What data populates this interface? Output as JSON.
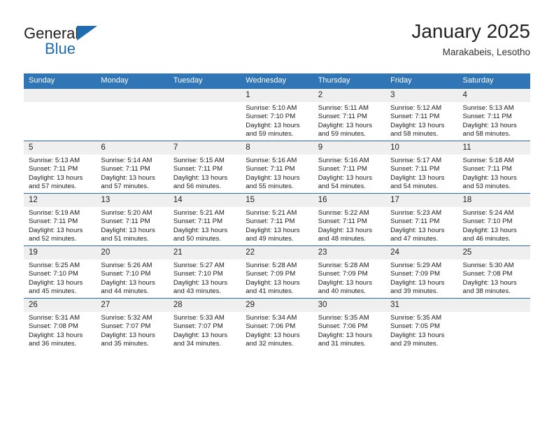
{
  "brand": {
    "name_line1": "General",
    "name_line2": "Blue",
    "triangle_color": "#1f6cb0"
  },
  "header": {
    "title": "January 2025",
    "subtitle": "Marakabeis, Lesotho"
  },
  "theme": {
    "header_bg": "#3075b5",
    "cell_border": "#2a6aa8",
    "daynum_bg": "#efefef",
    "accent": "#1f6cb0"
  },
  "weekday_headers": [
    "Sunday",
    "Monday",
    "Tuesday",
    "Wednesday",
    "Thursday",
    "Friday",
    "Saturday"
  ],
  "weeks": [
    [
      {
        "day": "",
        "sunrise": "",
        "sunset": "",
        "daylight_line1": "",
        "daylight_line2": ""
      },
      {
        "day": "",
        "sunrise": "",
        "sunset": "",
        "daylight_line1": "",
        "daylight_line2": ""
      },
      {
        "day": "",
        "sunrise": "",
        "sunset": "",
        "daylight_line1": "",
        "daylight_line2": ""
      },
      {
        "day": "1",
        "sunrise": "Sunrise: 5:10 AM",
        "sunset": "Sunset: 7:10 PM",
        "daylight_line1": "Daylight: 13 hours",
        "daylight_line2": "and 59 minutes."
      },
      {
        "day": "2",
        "sunrise": "Sunrise: 5:11 AM",
        "sunset": "Sunset: 7:11 PM",
        "daylight_line1": "Daylight: 13 hours",
        "daylight_line2": "and 59 minutes."
      },
      {
        "day": "3",
        "sunrise": "Sunrise: 5:12 AM",
        "sunset": "Sunset: 7:11 PM",
        "daylight_line1": "Daylight: 13 hours",
        "daylight_line2": "and 58 minutes."
      },
      {
        "day": "4",
        "sunrise": "Sunrise: 5:13 AM",
        "sunset": "Sunset: 7:11 PM",
        "daylight_line1": "Daylight: 13 hours",
        "daylight_line2": "and 58 minutes."
      }
    ],
    [
      {
        "day": "5",
        "sunrise": "Sunrise: 5:13 AM",
        "sunset": "Sunset: 7:11 PM",
        "daylight_line1": "Daylight: 13 hours",
        "daylight_line2": "and 57 minutes."
      },
      {
        "day": "6",
        "sunrise": "Sunrise: 5:14 AM",
        "sunset": "Sunset: 7:11 PM",
        "daylight_line1": "Daylight: 13 hours",
        "daylight_line2": "and 57 minutes."
      },
      {
        "day": "7",
        "sunrise": "Sunrise: 5:15 AM",
        "sunset": "Sunset: 7:11 PM",
        "daylight_line1": "Daylight: 13 hours",
        "daylight_line2": "and 56 minutes."
      },
      {
        "day": "8",
        "sunrise": "Sunrise: 5:16 AM",
        "sunset": "Sunset: 7:11 PM",
        "daylight_line1": "Daylight: 13 hours",
        "daylight_line2": "and 55 minutes."
      },
      {
        "day": "9",
        "sunrise": "Sunrise: 5:16 AM",
        "sunset": "Sunset: 7:11 PM",
        "daylight_line1": "Daylight: 13 hours",
        "daylight_line2": "and 54 minutes."
      },
      {
        "day": "10",
        "sunrise": "Sunrise: 5:17 AM",
        "sunset": "Sunset: 7:11 PM",
        "daylight_line1": "Daylight: 13 hours",
        "daylight_line2": "and 54 minutes."
      },
      {
        "day": "11",
        "sunrise": "Sunrise: 5:18 AM",
        "sunset": "Sunset: 7:11 PM",
        "daylight_line1": "Daylight: 13 hours",
        "daylight_line2": "and 53 minutes."
      }
    ],
    [
      {
        "day": "12",
        "sunrise": "Sunrise: 5:19 AM",
        "sunset": "Sunset: 7:11 PM",
        "daylight_line1": "Daylight: 13 hours",
        "daylight_line2": "and 52 minutes."
      },
      {
        "day": "13",
        "sunrise": "Sunrise: 5:20 AM",
        "sunset": "Sunset: 7:11 PM",
        "daylight_line1": "Daylight: 13 hours",
        "daylight_line2": "and 51 minutes."
      },
      {
        "day": "14",
        "sunrise": "Sunrise: 5:21 AM",
        "sunset": "Sunset: 7:11 PM",
        "daylight_line1": "Daylight: 13 hours",
        "daylight_line2": "and 50 minutes."
      },
      {
        "day": "15",
        "sunrise": "Sunrise: 5:21 AM",
        "sunset": "Sunset: 7:11 PM",
        "daylight_line1": "Daylight: 13 hours",
        "daylight_line2": "and 49 minutes."
      },
      {
        "day": "16",
        "sunrise": "Sunrise: 5:22 AM",
        "sunset": "Sunset: 7:11 PM",
        "daylight_line1": "Daylight: 13 hours",
        "daylight_line2": "and 48 minutes."
      },
      {
        "day": "17",
        "sunrise": "Sunrise: 5:23 AM",
        "sunset": "Sunset: 7:11 PM",
        "daylight_line1": "Daylight: 13 hours",
        "daylight_line2": "and 47 minutes."
      },
      {
        "day": "18",
        "sunrise": "Sunrise: 5:24 AM",
        "sunset": "Sunset: 7:10 PM",
        "daylight_line1": "Daylight: 13 hours",
        "daylight_line2": "and 46 minutes."
      }
    ],
    [
      {
        "day": "19",
        "sunrise": "Sunrise: 5:25 AM",
        "sunset": "Sunset: 7:10 PM",
        "daylight_line1": "Daylight: 13 hours",
        "daylight_line2": "and 45 minutes."
      },
      {
        "day": "20",
        "sunrise": "Sunrise: 5:26 AM",
        "sunset": "Sunset: 7:10 PM",
        "daylight_line1": "Daylight: 13 hours",
        "daylight_line2": "and 44 minutes."
      },
      {
        "day": "21",
        "sunrise": "Sunrise: 5:27 AM",
        "sunset": "Sunset: 7:10 PM",
        "daylight_line1": "Daylight: 13 hours",
        "daylight_line2": "and 43 minutes."
      },
      {
        "day": "22",
        "sunrise": "Sunrise: 5:28 AM",
        "sunset": "Sunset: 7:09 PM",
        "daylight_line1": "Daylight: 13 hours",
        "daylight_line2": "and 41 minutes."
      },
      {
        "day": "23",
        "sunrise": "Sunrise: 5:28 AM",
        "sunset": "Sunset: 7:09 PM",
        "daylight_line1": "Daylight: 13 hours",
        "daylight_line2": "and 40 minutes."
      },
      {
        "day": "24",
        "sunrise": "Sunrise: 5:29 AM",
        "sunset": "Sunset: 7:09 PM",
        "daylight_line1": "Daylight: 13 hours",
        "daylight_line2": "and 39 minutes."
      },
      {
        "day": "25",
        "sunrise": "Sunrise: 5:30 AM",
        "sunset": "Sunset: 7:08 PM",
        "daylight_line1": "Daylight: 13 hours",
        "daylight_line2": "and 38 minutes."
      }
    ],
    [
      {
        "day": "26",
        "sunrise": "Sunrise: 5:31 AM",
        "sunset": "Sunset: 7:08 PM",
        "daylight_line1": "Daylight: 13 hours",
        "daylight_line2": "and 36 minutes."
      },
      {
        "day": "27",
        "sunrise": "Sunrise: 5:32 AM",
        "sunset": "Sunset: 7:07 PM",
        "daylight_line1": "Daylight: 13 hours",
        "daylight_line2": "and 35 minutes."
      },
      {
        "day": "28",
        "sunrise": "Sunrise: 5:33 AM",
        "sunset": "Sunset: 7:07 PM",
        "daylight_line1": "Daylight: 13 hours",
        "daylight_line2": "and 34 minutes."
      },
      {
        "day": "29",
        "sunrise": "Sunrise: 5:34 AM",
        "sunset": "Sunset: 7:06 PM",
        "daylight_line1": "Daylight: 13 hours",
        "daylight_line2": "and 32 minutes."
      },
      {
        "day": "30",
        "sunrise": "Sunrise: 5:35 AM",
        "sunset": "Sunset: 7:06 PM",
        "daylight_line1": "Daylight: 13 hours",
        "daylight_line2": "and 31 minutes."
      },
      {
        "day": "31",
        "sunrise": "Sunrise: 5:35 AM",
        "sunset": "Sunset: 7:05 PM",
        "daylight_line1": "Daylight: 13 hours",
        "daylight_line2": "and 29 minutes."
      },
      {
        "day": "",
        "sunrise": "",
        "sunset": "",
        "daylight_line1": "",
        "daylight_line2": ""
      }
    ]
  ]
}
